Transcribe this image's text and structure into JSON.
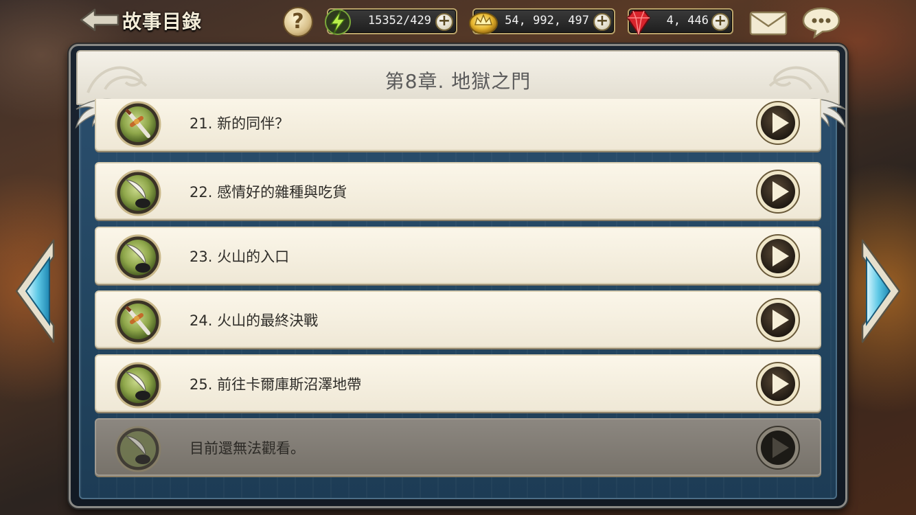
{
  "header": {
    "title": "故事目錄",
    "help_label": "?",
    "energy": "15352/429",
    "gold": "54, 992, 497",
    "gems": "4, 446",
    "plus_label": "+"
  },
  "panel": {
    "chapter_title": "第8章.  地獄之門"
  },
  "stories": [
    {
      "label": "21.  新的同伴？",
      "icon": "sword-icon",
      "locked": false
    },
    {
      "label": "22.  感情好的雜種與吃貨",
      "icon": "quill-ink-icon",
      "locked": false
    },
    {
      "label": "23.  火山的入口",
      "icon": "quill-ink-icon",
      "locked": false
    },
    {
      "label": "24.  火山的最終決戰",
      "icon": "sword-icon",
      "locked": false
    },
    {
      "label": "25.  前往卡爾庫斯沼澤地帶",
      "icon": "quill-ink-icon",
      "locked": false
    },
    {
      "label": "目前還無法觀看。",
      "icon": "quill-ink-icon",
      "locked": true
    }
  ]
}
